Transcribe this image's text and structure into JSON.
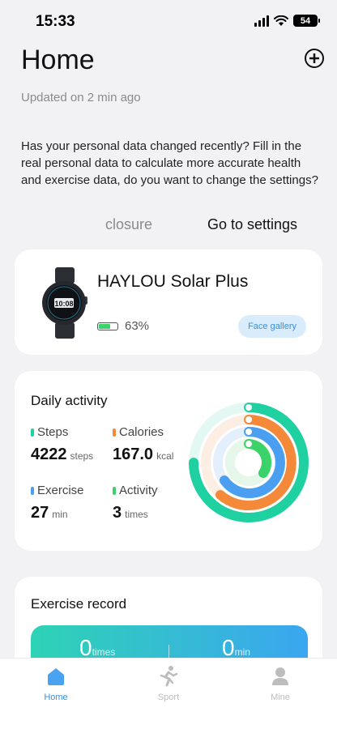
{
  "status": {
    "time": "15:33",
    "battery": "54"
  },
  "header": {
    "title": "Home",
    "updated": "Updated on 2 min ago"
  },
  "notice": {
    "text": "Has your personal data changed recently? Fill in the real personal data to calculate more accurate health and exercise data, do you want to change the settings?",
    "closure": "closure",
    "settings": "Go to settings"
  },
  "device": {
    "name": "HAYLOU Solar Plus",
    "watch_time": "10:08",
    "battery_pct": "63%",
    "battery_level": 0.63,
    "face_gallery": "Face gallery"
  },
  "activity": {
    "title": "Daily activity",
    "steps": {
      "label": "Steps",
      "value": "4222",
      "unit": "steps",
      "color": "#1fd0a0"
    },
    "calories": {
      "label": "Calories",
      "value": "167.0",
      "unit": "kcal",
      "color": "#f5893a"
    },
    "exercise": {
      "label": "Exercise",
      "value": "27",
      "unit": "min",
      "color": "#4a9ff0"
    },
    "activity_count": {
      "label": "Activity",
      "value": "3",
      "unit": "times",
      "color": "#3ad36a"
    }
  },
  "exercise_record": {
    "title": "Exercise record",
    "times_value": "0",
    "times_unit": "times",
    "min_value": "0",
    "min_unit": "min"
  },
  "nav": {
    "home": "Home",
    "sport": "Sport",
    "mine": "Mine",
    "active_color": "#3a8fd9"
  }
}
